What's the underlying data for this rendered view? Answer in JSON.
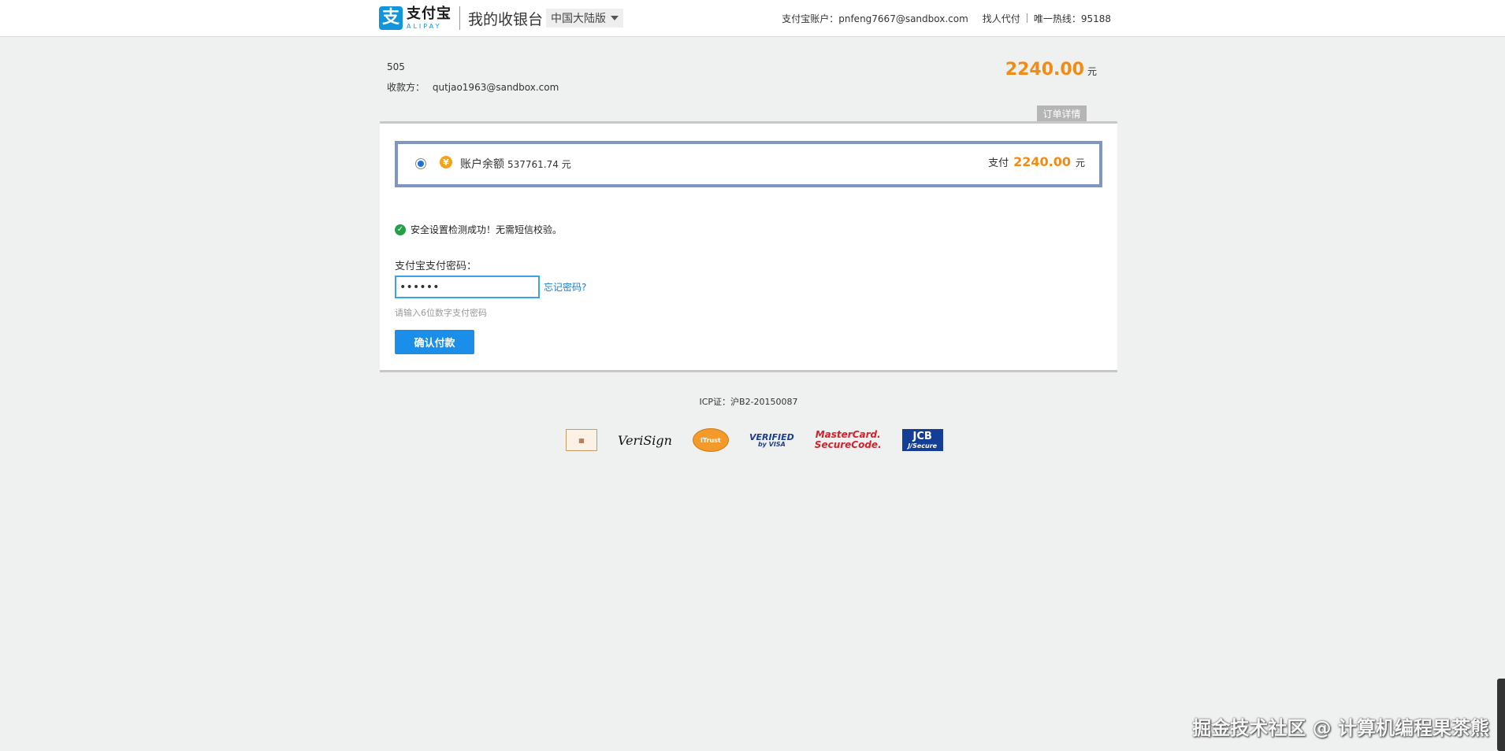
{
  "header": {
    "logo_glyph": "支",
    "logo_cn": "支付宝",
    "logo_en": "ALIPAY",
    "site_title": "我的收银台",
    "region": "中国大陆版",
    "account_label": "支付宝账户：",
    "account_email": "pnfeng7667@sandbox.com",
    "proxy_pay": "找人代付",
    "hotline": "唯一热线：95188"
  },
  "order": {
    "id": "505",
    "payee_label": "收款方：",
    "payee": "qutjao1963@sandbox.com",
    "amount": "2240.00",
    "unit": "元",
    "detail_tab": "订单详情"
  },
  "payment": {
    "method_label": "账户余额",
    "balance": "537761.74 元",
    "pay_label": "支付",
    "pay_amount": "2240.00",
    "pay_unit": "元",
    "security_msg": "安全设置检测成功！无需短信校验。",
    "password_label": "支付宝支付密码：",
    "password_value": "••••••",
    "forgot_link": "忘记密码?",
    "hint": "请输入6位数字支付密码",
    "confirm_button": "确认付款"
  },
  "footer": {
    "icp": "ICP证：沪B2-20150087",
    "certs": {
      "verisign": "VeriSign",
      "itrust": "iTrust",
      "visa_top": "VERIFIED",
      "visa_bottom": "by VISA",
      "mc_top": "MasterCard.",
      "mc_bottom": "SecureCode.",
      "jcb_top": "JCB",
      "jcb_bottom": "J/Secure"
    }
  },
  "watermark": "掘金技术社区 @ 计算机编程果茶熊",
  "colors": {
    "accent": "#1a8ee8",
    "amount": "#f28b14",
    "success": "#23a048"
  },
  "icons": {
    "coin": "yuan-coin-icon",
    "check": "check-circle-icon",
    "caret": "caret-down-icon"
  }
}
